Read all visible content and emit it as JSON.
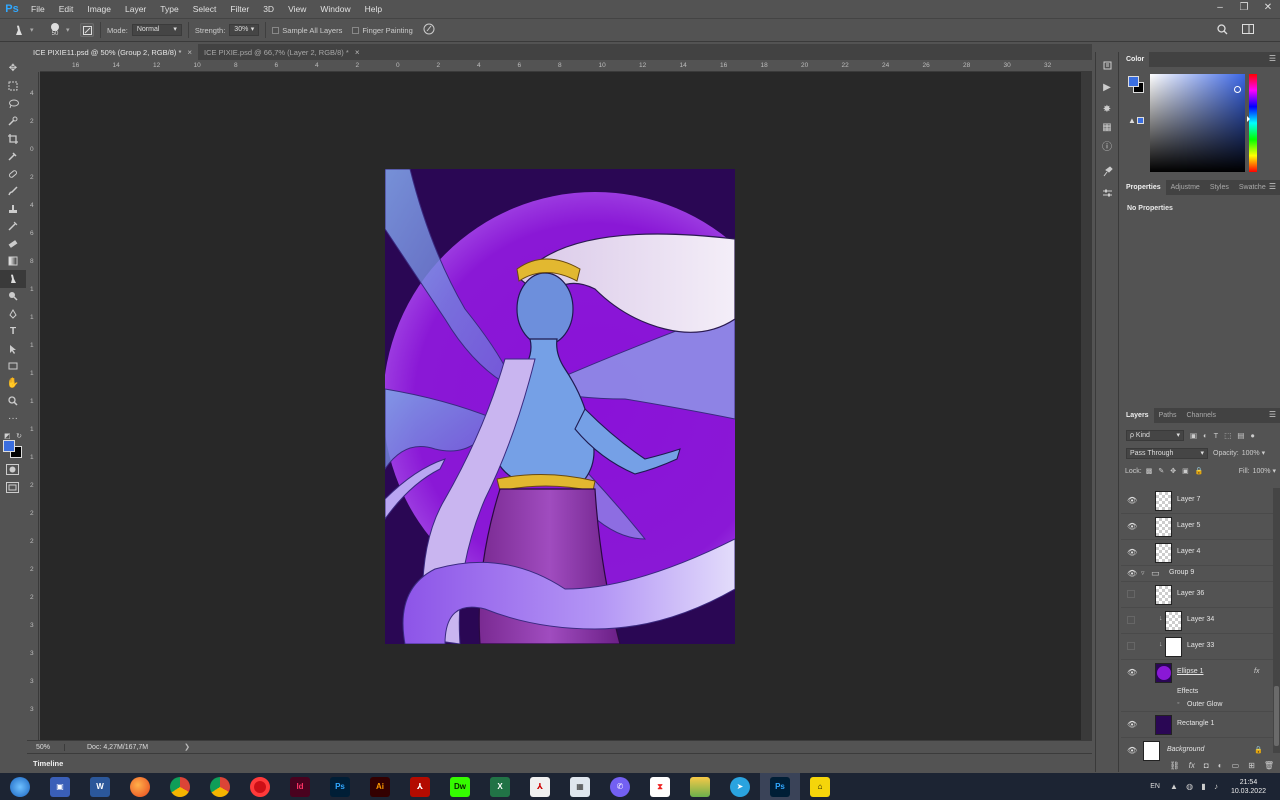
{
  "app": {
    "logo": "Ps",
    "menu": [
      "File",
      "Edit",
      "Image",
      "Layer",
      "Type",
      "Select",
      "Filter",
      "3D",
      "View",
      "Window",
      "Help"
    ],
    "window_controls": [
      "–",
      "❐",
      "✕"
    ]
  },
  "options_bar": {
    "brush_size": "50",
    "mode_label": "Mode:",
    "mode_value": "Normal",
    "strength_label": "Strength:",
    "strength_value": "30%",
    "sample_all_layers": "Sample All Layers",
    "finger_painting": "Finger Painting",
    "search_icon": "search-icon",
    "workspace_icon": "workspace-icon"
  },
  "doc_tabs": [
    {
      "label": "ICE PIXIE11.psd @ 50% (Group 2, RGB/8) *",
      "close": "×",
      "active": true
    },
    {
      "label": "ICE PIXIE.psd @ 66,7% (Layer 2, RGB/8) *",
      "close": "×",
      "active": false
    }
  ],
  "ruler": {
    "h_ticks": [
      "16",
      "14",
      "12",
      "10",
      "8",
      "6",
      "4",
      "2",
      "0",
      "2",
      "4",
      "6",
      "8",
      "10",
      "12",
      "14",
      "16",
      "18",
      "20",
      "22",
      "24",
      "26",
      "28",
      "30",
      "32"
    ],
    "v_ticks": [
      "4",
      "2",
      "0",
      "2",
      "4",
      "6",
      "8",
      "1",
      "1",
      "1",
      "1",
      "1",
      "1",
      "1",
      "2",
      "2",
      "2",
      "2",
      "2",
      "3",
      "3",
      "3",
      "3"
    ]
  },
  "status_bar": {
    "zoom": "50%",
    "doc": "Doc: 4,27M/167,7M",
    "arrow": "❯"
  },
  "timeline": {
    "label": "Timeline"
  },
  "panels": {
    "color": {
      "tab": "Color",
      "menu": "☰"
    },
    "properties": {
      "tabs": [
        "Properties",
        "Adjustme",
        "Styles",
        "Swatche"
      ],
      "empty": "No Properties"
    },
    "layers": {
      "tabs": [
        "Layers",
        "Paths",
        "Channels"
      ],
      "filter_kind": "ρ Kind",
      "blend_mode": "Pass Through",
      "opacity_label": "Opacity:",
      "opacity_value": "100%",
      "lock_label": "Lock:",
      "fill_label": "Fill:",
      "fill_value": "100%",
      "items": [
        {
          "name": "Layer 7",
          "visible": true
        },
        {
          "name": "Layer 5",
          "visible": true
        },
        {
          "name": "Layer 4",
          "visible": true
        },
        {
          "name": "Group 9",
          "visible": true
        },
        {
          "name": "Layer 36",
          "visible": false
        },
        {
          "name": "Layer 34",
          "visible": false
        },
        {
          "name": "Layer 33",
          "visible": false
        },
        {
          "name": "Ellipse 1",
          "visible": true,
          "fx": "fx"
        },
        {
          "name": "Effects"
        },
        {
          "name": "Outer Glow"
        },
        {
          "name": "Rectangle 1",
          "visible": true
        },
        {
          "name": "Background",
          "visible": true
        }
      ],
      "footer_icons": [
        "link-icon",
        "fx-icon",
        "mask-icon",
        "adjustment-icon",
        "group-icon",
        "new-layer-icon",
        "trash-icon"
      ]
    }
  },
  "taskbar": {
    "apps": [
      "start",
      "save",
      "W",
      "firefox",
      "chrome",
      "chrome",
      "opera",
      "Id",
      "Ps",
      "Ai",
      "acrobat",
      "Dw",
      "excel",
      "pdf",
      "calc",
      "viber",
      "app",
      "layers",
      "telegram",
      "Ps",
      "batman"
    ],
    "lang": "EN",
    "time": "21:54",
    "date": "10.03.2022"
  },
  "colors": {
    "foreground": "#3a6ee0",
    "background": "#000000",
    "artwork_bg": "#2a0754",
    "moon": "#8a18d6"
  }
}
